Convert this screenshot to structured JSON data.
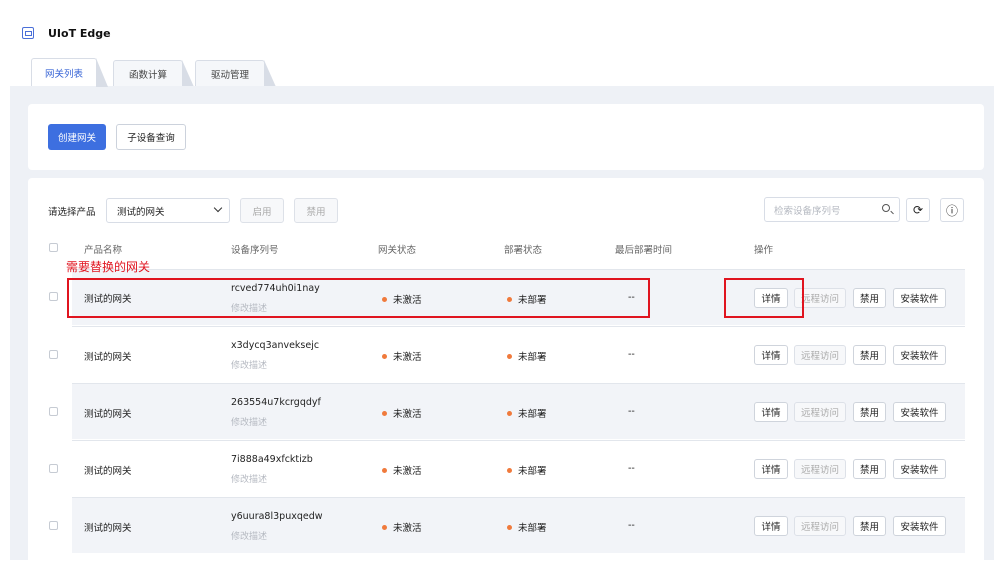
{
  "app": {
    "title": "UIoT Edge",
    "logo_icon": "device-box-icon"
  },
  "tabs": [
    {
      "label": "网关列表",
      "active": true
    },
    {
      "label": "函数计算",
      "active": false
    },
    {
      "label": "驱动管理",
      "active": false
    }
  ],
  "toolbar": {
    "create_label": "创建网关",
    "query_label": "子设备查询"
  },
  "filter": {
    "label": "请选择产品",
    "selected": "测试的网关",
    "enable_label": "启用",
    "disable_label": "禁用",
    "search_placeholder": "检索设备序列号"
  },
  "table": {
    "headers": [
      "产品名称",
      "设备序列号",
      "网关状态",
      "部署状态",
      "最后部署时间",
      "操作"
    ],
    "rows": [
      {
        "product": "测试的网关",
        "serial": "rcved774uh0i1nay",
        "desc": "修改描述",
        "gw_status": "未激活",
        "deploy_status": "未部署",
        "last_deploy": "--"
      },
      {
        "product": "测试的网关",
        "serial": "x3dycq3anveksejc",
        "desc": "修改描述",
        "gw_status": "未激活",
        "deploy_status": "未部署",
        "last_deploy": "--"
      },
      {
        "product": "测试的网关",
        "serial": "263554u7kcrgqdyf",
        "desc": "修改描述",
        "gw_status": "未激活",
        "deploy_status": "未部署",
        "last_deploy": "--"
      },
      {
        "product": "测试的网关",
        "serial": "7i888a49xfcktizb",
        "desc": "修改描述",
        "gw_status": "未激活",
        "deploy_status": "未部署",
        "last_deploy": "--"
      },
      {
        "product": "测试的网关",
        "serial": "y6uura8l3puxqedw",
        "desc": "修改描述",
        "gw_status": "未激活",
        "deploy_status": "未部署",
        "last_deploy": "--"
      }
    ],
    "actions": {
      "detail": "详情",
      "remote": "远程访问",
      "disable": "禁用",
      "install": "安装软件"
    }
  },
  "annotation": {
    "text": "需要替换的网关",
    "color": "#e0141f"
  },
  "colors": {
    "accent": "#3d6fe0",
    "status_dot": "#f07a3c"
  }
}
